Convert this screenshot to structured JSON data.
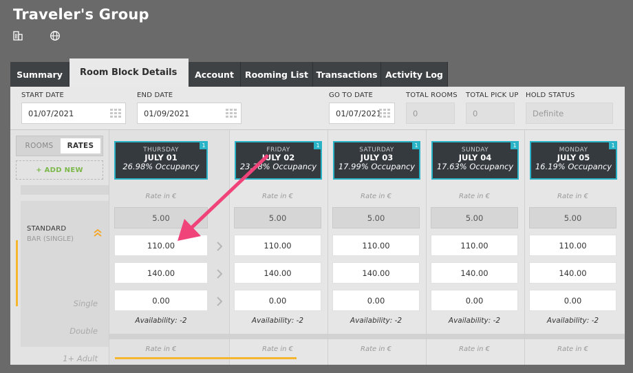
{
  "app": {
    "title": "Traveler's Group"
  },
  "header_icons": [
    "building-icon",
    "globe-icon"
  ],
  "tabs": [
    {
      "label": "Summary"
    },
    {
      "label": "Room Block Details"
    },
    {
      "label": "Account"
    },
    {
      "label": "Rooming List"
    },
    {
      "label": "Transactions"
    },
    {
      "label": "Activity Log"
    }
  ],
  "fields": {
    "start_date": {
      "label": "START DATE",
      "value": "01/07/2021"
    },
    "end_date": {
      "label": "END DATE",
      "value": "01/09/2021"
    },
    "go_to_date": {
      "label": "GO TO DATE",
      "value": "01/07/2021"
    },
    "total_rooms": {
      "label": "TOTAL ROOMS",
      "value": "0"
    },
    "total_pick_up": {
      "label": "TOTAL PICK UP",
      "value": "0"
    },
    "hold_status": {
      "label": "HOLD STATUS",
      "value": "Definite"
    }
  },
  "toggle": {
    "rooms": "ROOMS",
    "rates": "RATES"
  },
  "add_new": "+ ADD NEW",
  "room": {
    "name": "STANDARD",
    "sub": "BAR (SINGLE)",
    "occupancies": [
      "Single",
      "Double",
      "1+ Adult"
    ]
  },
  "rate_label": "Rate in €",
  "days": [
    {
      "weekday": "THURSDAY",
      "date": "JULY 01",
      "occupancy": "26.98% Occupancy",
      "badge": "1",
      "base": "5.00",
      "single": "110.00",
      "double": "140.00",
      "adult": "0.00",
      "availability": "Availability: -2"
    },
    {
      "weekday": "FRIDAY",
      "date": "JULY 02",
      "occupancy": "23.38% Occupancy",
      "badge": "1",
      "base": "5.00",
      "single": "110.00",
      "double": "140.00",
      "adult": "0.00",
      "availability": "Availability: -2"
    },
    {
      "weekday": "SATURDAY",
      "date": "JULY 03",
      "occupancy": "17.99% Occupancy",
      "badge": "1",
      "base": "5.00",
      "single": "110.00",
      "double": "140.00",
      "adult": "0.00",
      "availability": "Availability: -2"
    },
    {
      "weekday": "SUNDAY",
      "date": "JULY 04",
      "occupancy": "17.63% Occupancy",
      "badge": "1",
      "base": "5.00",
      "single": "110.00",
      "double": "140.00",
      "adult": "0.00",
      "availability": "Availability: -2"
    },
    {
      "weekday": "MONDAY",
      "date": "JULY 05",
      "occupancy": "16.19% Occupancy",
      "badge": "1",
      "base": "5.00",
      "single": "110.00",
      "double": "140.00",
      "adult": "0.00",
      "availability": "Availability: -2"
    }
  ],
  "colors": {
    "accent": "#2ab3c6",
    "highlight": "#f5b52e",
    "annotation": "#f0437a",
    "tab_dark": "#3f4245"
  }
}
